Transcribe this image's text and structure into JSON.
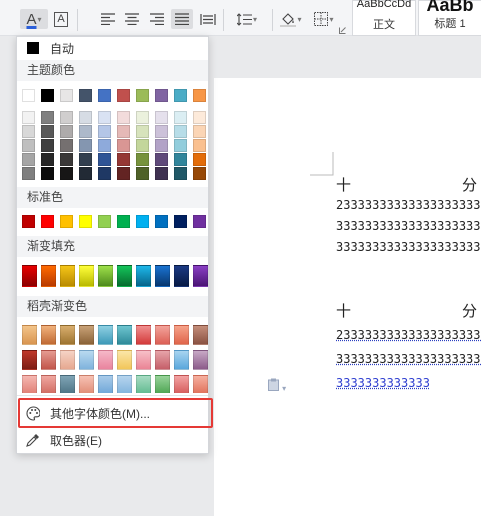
{
  "toolbar": {
    "font_color_letter": "A",
    "border_letter": "A",
    "style_normal_preview": "AaBbCcDd",
    "style_normal_label": "正文",
    "style_h1_preview": "AaBb",
    "style_h1_label": "标题 1"
  },
  "menu": {
    "auto_label": "自动",
    "theme_header": "主题颜色",
    "standard_header": "标准色",
    "gradient_header": "渐变填充",
    "daoke_header": "稻壳渐变色",
    "more_colors_label": "其他字体颜色(M)...",
    "picker_label": "取色器(E)"
  },
  "theme_colors": {
    "base": [
      "#ffffff",
      "#000000",
      "#e7e6e6",
      "#44546a",
      "#4472c4",
      "#c0504d",
      "#9bbb59",
      "#8064a2",
      "#4bacc6",
      "#f79646"
    ],
    "tints": [
      [
        "#f2f2f2",
        "#7f7f7f",
        "#d0cece",
        "#d6dce4",
        "#d9e2f3",
        "#f2dbdb",
        "#ebf1dd",
        "#e5e0ec",
        "#dbeef3",
        "#fdeada"
      ],
      [
        "#d8d8d8",
        "#595959",
        "#aeabab",
        "#adb9ca",
        "#b4c6e7",
        "#e5b9b7",
        "#d7e3bc",
        "#ccc1d9",
        "#b7dde8",
        "#fbd5b5"
      ],
      [
        "#bfbfbf",
        "#3f3f3f",
        "#757070",
        "#8496b0",
        "#8eaadb",
        "#d99694",
        "#c3d69b",
        "#b2a2c7",
        "#92cddc",
        "#fac08f"
      ],
      [
        "#a5a5a5",
        "#262626",
        "#3a3838",
        "#323f4f",
        "#2f5496",
        "#953734",
        "#76923c",
        "#5f497a",
        "#31859b",
        "#e36c09"
      ],
      [
        "#7f7f7f",
        "#0c0c0c",
        "#171616",
        "#222a35",
        "#1f3864",
        "#632423",
        "#4f6128",
        "#3f3151",
        "#205867",
        "#974806"
      ]
    ]
  },
  "standard_colors": [
    "#c00000",
    "#ff0000",
    "#ffc000",
    "#ffff00",
    "#92d050",
    "#00b050",
    "#00b0f0",
    "#0070c0",
    "#002060",
    "#7030a0"
  ],
  "gradient_fills": [
    [
      "#e80000",
      "#8b0000"
    ],
    [
      "#ff6a00",
      "#b83a00"
    ],
    [
      "#f5c518",
      "#b88a00"
    ],
    [
      "#ffff3a",
      "#b8b800"
    ],
    [
      "#9ee04a",
      "#4d8a1c"
    ],
    [
      "#14c45a",
      "#066b2e"
    ],
    [
      "#1eb8ea",
      "#06648a"
    ],
    [
      "#1a73d1",
      "#08366e"
    ],
    [
      "#1c3a84",
      "#081a44"
    ],
    [
      "#8a3fc4",
      "#4a1474"
    ]
  ],
  "daoke_rows": [
    [
      [
        "#f3c48a",
        "#d99550"
      ],
      [
        "#f1b27c",
        "#c06a34"
      ],
      [
        "#d9ae6e",
        "#9d7430"
      ],
      [
        "#c9a277",
        "#8a6237"
      ],
      [
        "#8fd0e2",
        "#3d99b8"
      ],
      [
        "#6ec5cf",
        "#2e8a99"
      ],
      [
        "#f09090",
        "#d33a3a"
      ],
      [
        "#f3a49b",
        "#dc5f55"
      ],
      [
        "#f6a38a",
        "#e0644a"
      ],
      [
        "#c48d7a",
        "#8a5242"
      ]
    ],
    [
      [
        "#c0392b",
        "#7d1d14"
      ],
      [
        "#e59b91",
        "#c2564b"
      ],
      [
        "#f5d3c5",
        "#e6a890"
      ],
      [
        "#b9d9f0",
        "#7fb3dc"
      ],
      [
        "#f5b8c8",
        "#e9849e"
      ],
      [
        "#fbe6a8",
        "#f2c65a"
      ],
      [
        "#f7c0c8",
        "#ea8495"
      ],
      [
        "#e7a4a9",
        "#c55f69"
      ],
      [
        "#a8d4f0",
        "#5aa7dc"
      ],
      [
        "#c7a8c5",
        "#8c5c8a"
      ]
    ],
    [
      [
        "#f5b7b1",
        "#e07e74"
      ],
      [
        "#f0a7a0",
        "#d06a60"
      ],
      [
        "#7fa4b5",
        "#4d7384"
      ],
      [
        "#f7c1b4",
        "#e08b75"
      ],
      [
        "#a9cbea",
        "#6ea6d8"
      ],
      [
        "#b6d5ee",
        "#80b3dd"
      ],
      [
        "#a8dcc3",
        "#60b98f"
      ],
      [
        "#98d39a",
        "#4ca451"
      ],
      [
        "#f3a3a3",
        "#d55a5a"
      ],
      [
        "#f6b0a0",
        "#e0705a"
      ]
    ]
  ],
  "doc": {
    "cjk_left_1": "十",
    "cjk_right_1": "分",
    "line1": "233333333333333333333",
    "line2": "333333333333333333333",
    "line3": "333333333333333333333",
    "cjk_left_2": "十",
    "cjk_right_2": "分",
    "line4": "233333333333333333333",
    "line5": "333333333333333333333",
    "line6": "3333333333333"
  }
}
